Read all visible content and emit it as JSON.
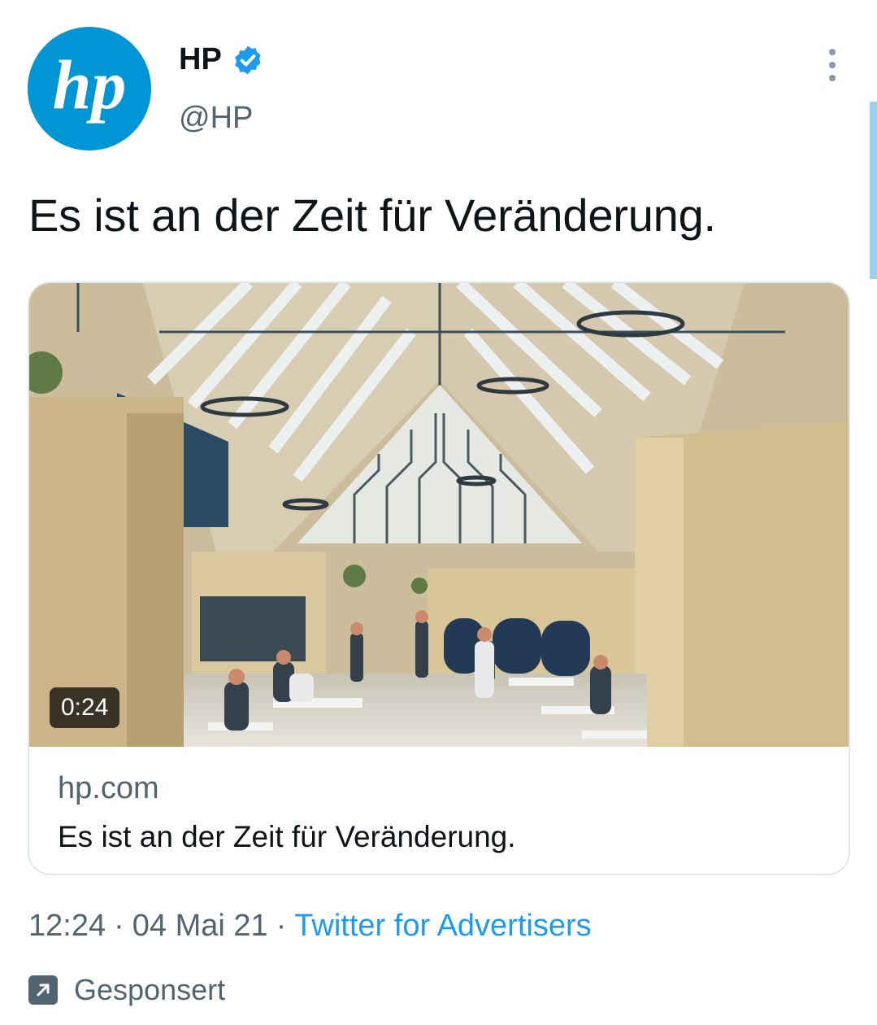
{
  "tweet": {
    "display_name": "HP",
    "handle": "@HP",
    "verified": true,
    "verified_icon": "verified-badge-icon",
    "more_icon": "more-options-icon",
    "text": "Es ist an der Zeit für Veränderung.",
    "avatar_logo": "hp",
    "card": {
      "video_duration": "0:24",
      "domain": "hp.com",
      "title": "Es ist an der Zeit für Veränderung."
    },
    "time": "12:24",
    "date": "04 Mai 21",
    "separator": "·",
    "source": "Twitter for Advertisers",
    "promoted_icon": "promoted-arrow-icon",
    "sponsored_label": "Gesponsert"
  },
  "colors": {
    "hp_blue": "#0096d6",
    "twitter_blue": "#1d9bf0",
    "secondary_text": "#536471",
    "primary_text": "#0f1419"
  }
}
